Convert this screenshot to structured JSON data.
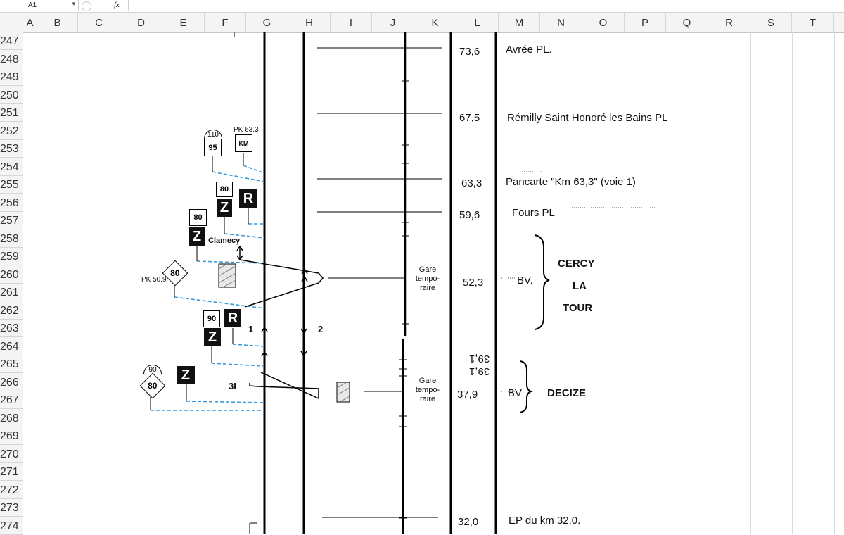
{
  "formula_bar": {
    "cell_ref": "A1",
    "fx_label": "fx",
    "value": ""
  },
  "columns": [
    "A",
    "B",
    "C",
    "D",
    "E",
    "F",
    "G",
    "H",
    "I",
    "J",
    "K",
    "L",
    "M",
    "N",
    "O",
    "P",
    "Q",
    "R",
    "S",
    "T"
  ],
  "rows": [
    "247",
    "248",
    "249",
    "250",
    "251",
    "252",
    "253",
    "254",
    "255",
    "256",
    "257",
    "258",
    "259",
    "260",
    "261",
    "262",
    "263",
    "264",
    "265",
    "266",
    "267",
    "268",
    "269",
    "270",
    "271",
    "272",
    "273",
    "274"
  ],
  "km_marks": {
    "k1": "73,6",
    "k2": "67,5",
    "k3": "63,3",
    "k4": "59,6",
    "k5": "52,3",
    "k6": "39,1",
    "k7": "39,1",
    "k8": "37,9",
    "k9": "32,0"
  },
  "descriptions": {
    "d1": "Avrée PL.",
    "d2": "Rémilly Saint Honoré les Bains   PL",
    "d3": "Pancarte \"Km 63,3\" (voie 1)",
    "d4": "Fours PL",
    "d5": "BV.",
    "d6": "BV",
    "d7": "EP du km 32,0."
  },
  "stations": {
    "cercy": [
      "CERCY",
      "LA",
      "TOUR"
    ],
    "decize": "DECIZE"
  },
  "gares": {
    "g1": [
      "Gare",
      "tempo-",
      "raire"
    ],
    "g2": [
      "Gare",
      "tempo-",
      "raire"
    ]
  },
  "signals": {
    "dome_110": "110",
    "sig_95": "95",
    "pk_63_3": "PK 63,3",
    "km_board": "KM",
    "sig_80_a": "80",
    "z_a": "Z",
    "r_a": "R",
    "sig_80_b": "80",
    "z_b": "Z",
    "clamecy": "Clamecy",
    "pk_50_9": "PK 50,9",
    "diamond_80": "80",
    "sig_90": "90",
    "z_c": "Z",
    "r_b": "R",
    "track_1": "1",
    "track_2": "2",
    "dome_90": "90",
    "diamond_80_b": "80",
    "z_d": "Z",
    "track_3i": "3I"
  }
}
